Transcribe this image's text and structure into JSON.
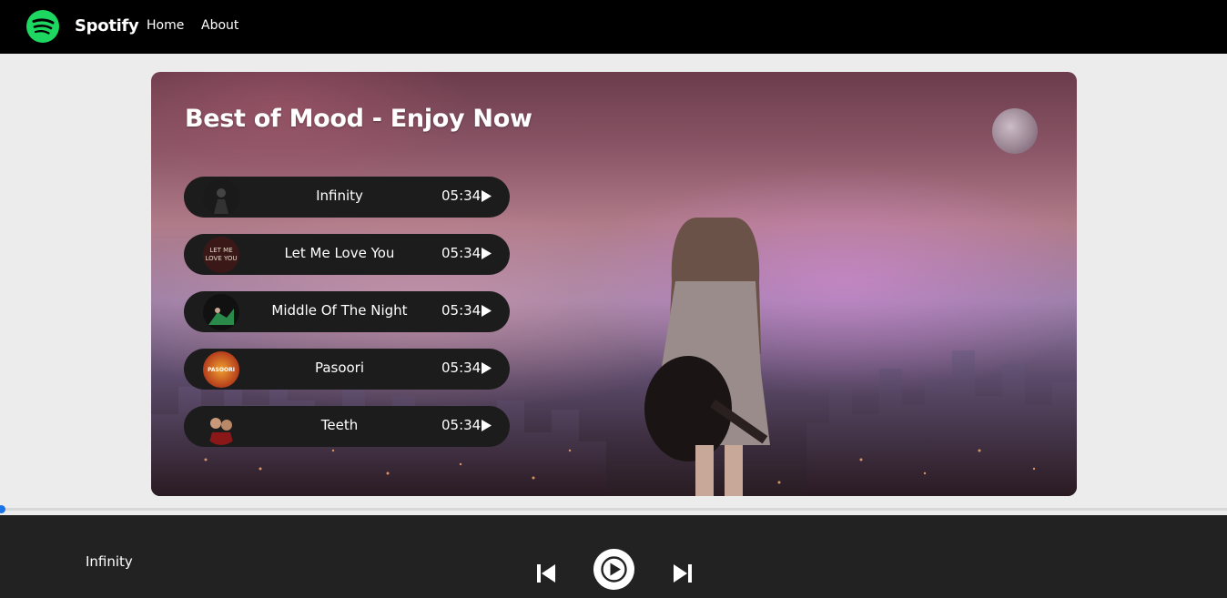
{
  "nav": {
    "brand": "Spotify",
    "links": [
      {
        "label": "Home"
      },
      {
        "label": "About"
      }
    ]
  },
  "hero": {
    "title": "Best of Mood - Enjoy Now"
  },
  "songs": [
    {
      "name": "Infinity",
      "duration": "05:34"
    },
    {
      "name": "Let Me Love You",
      "duration": "05:34"
    },
    {
      "name": "Middle Of The Night",
      "duration": "05:34"
    },
    {
      "name": "Pasoori",
      "duration": "05:34"
    },
    {
      "name": "Teeth",
      "duration": "05:34"
    }
  ],
  "thumb_text": {
    "let_me_love_you": [
      "LET ME",
      "LOVE YOU"
    ],
    "pasoori": "PASOORI"
  },
  "player": {
    "now_playing": "Infinity",
    "progress": 0
  },
  "colors": {
    "accent": "#1ed760",
    "progress": "#1a73e8",
    "player_bg": "#222222",
    "nav_bg": "#000000"
  },
  "icons": {
    "logo": "spotify-logo-icon",
    "play": "play-icon",
    "previous": "skip-previous-icon",
    "next": "skip-next-icon"
  }
}
